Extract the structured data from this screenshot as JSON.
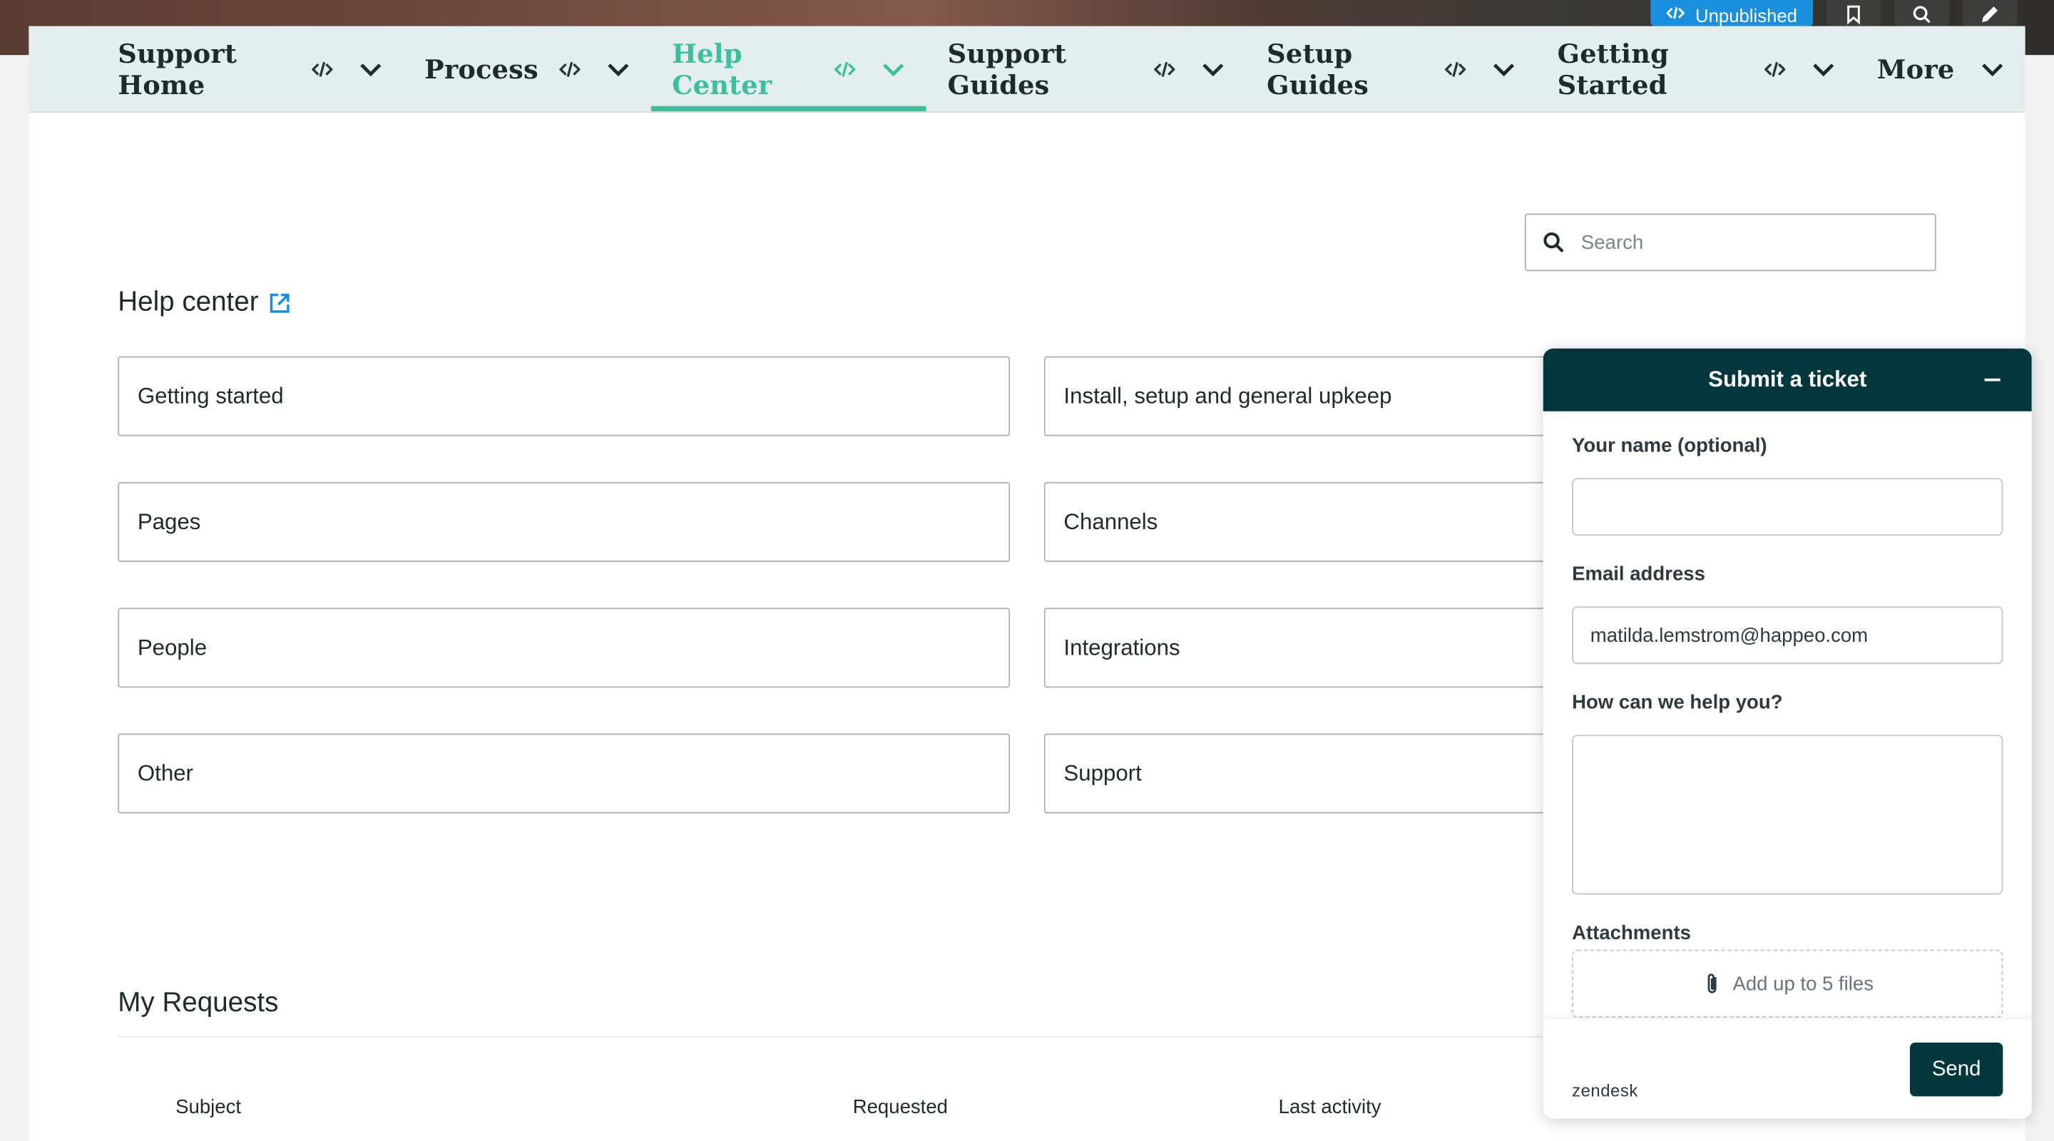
{
  "toolbar": {
    "unpublished_label": "Unpublished",
    "bookmark_icon": "bookmark-icon",
    "search_icon": "search-icon",
    "edit_icon": "pencil-icon"
  },
  "nav": {
    "items": [
      {
        "label": "Support Home"
      },
      {
        "label": "Process"
      },
      {
        "label": "Help Center",
        "active": true
      },
      {
        "label": "Support Guides"
      },
      {
        "label": "Setup Guides"
      },
      {
        "label": "Getting Started"
      },
      {
        "label": "More"
      }
    ]
  },
  "search": {
    "placeholder": "Search"
  },
  "help_center": {
    "title": "Help center",
    "categories": [
      "Getting started",
      "Install, setup and general upkeep",
      "Pages",
      "Channels",
      "People",
      "Integrations",
      "Other",
      "Support"
    ]
  },
  "requests": {
    "title": "My Requests",
    "columns": [
      "Subject",
      "Requested",
      "Last activity"
    ]
  },
  "widget": {
    "title": "Submit a ticket",
    "name_label": "Your name (optional)",
    "name_value": "",
    "email_label": "Email address",
    "email_value": "matilda.lemstrom@happeo.com",
    "help_label": "How can we help you?",
    "help_value": "",
    "attachments_label": "Attachments",
    "attachments_hint": "Add up to 5 files",
    "brand": "zendesk",
    "send_label": "Send"
  },
  "colors": {
    "accent": "#3bbf9d",
    "nav_bg": "#e4eeee",
    "widget_header": "#03363d",
    "unpublished_blue": "#1a8fdd"
  }
}
